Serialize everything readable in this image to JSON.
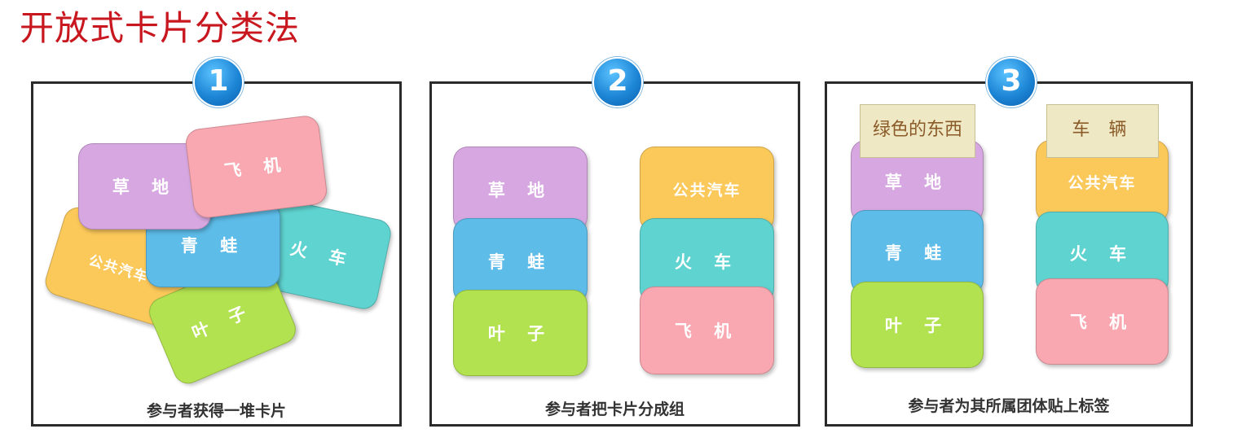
{
  "title": "开放式卡片分类法",
  "steps": [
    {
      "number": "1",
      "caption": "参与者获得一堆卡片",
      "cards": [
        "公共汽车",
        "火 车",
        "叶 子",
        "青 蛙",
        "草 地",
        "飞 机"
      ]
    },
    {
      "number": "2",
      "caption": "参与者把卡片分成组",
      "groups": [
        [
          "草 地",
          "青 蛙",
          "叶 子"
        ],
        [
          "公共汽车",
          "火 车",
          "飞 机"
        ]
      ]
    },
    {
      "number": "3",
      "caption": "参与者为其所属团体贴上标签",
      "group_labels": [
        "绿色的东西",
        "车 辆"
      ],
      "groups": [
        [
          "草 地",
          "青 蛙",
          "叶 子"
        ],
        [
          "公共汽车",
          "火 车",
          "飞 机"
        ]
      ]
    }
  ],
  "colors": {
    "title": "#c8171e",
    "purple": "#d6a7e0",
    "pink": "#f9a7b0",
    "orange": "#fbc85a",
    "blue": "#5dbce8",
    "teal": "#5fd3d0",
    "green": "#b2e24f",
    "label_bg": "#efe8c4"
  }
}
